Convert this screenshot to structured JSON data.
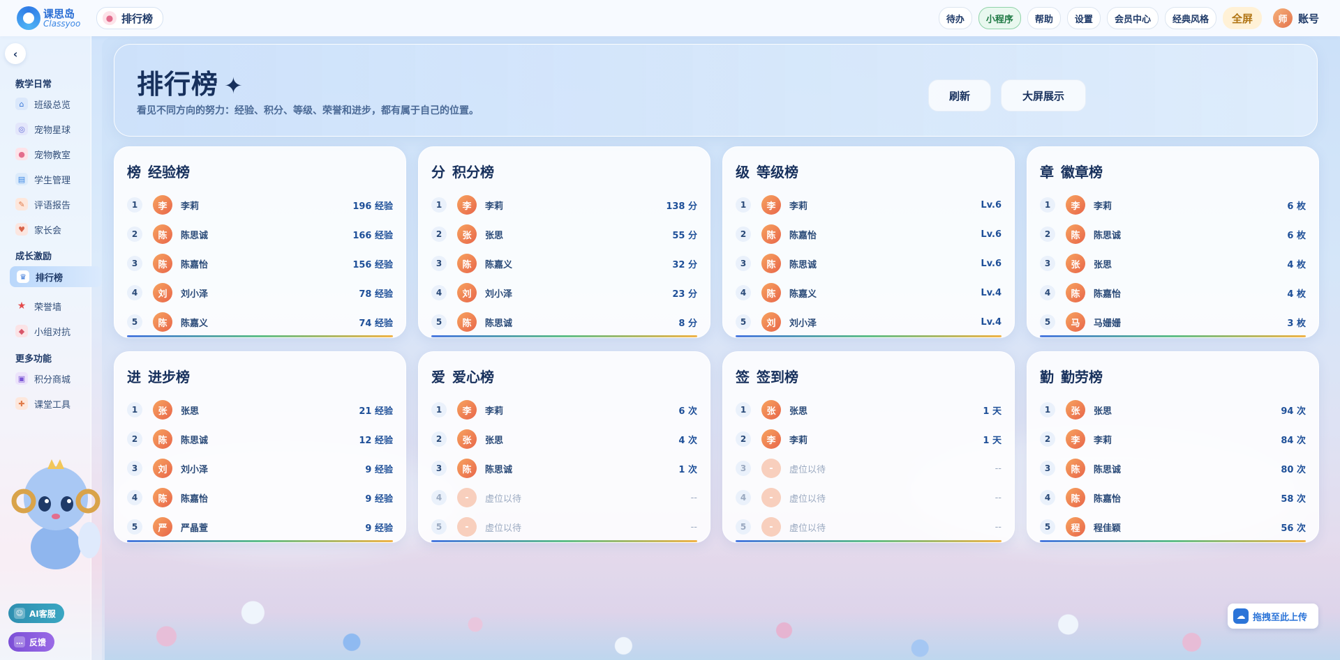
{
  "app": {
    "logo_cn": "课思岛",
    "logo_en": "Classyoo",
    "page_chip": "排行榜"
  },
  "topbar": {
    "buttons": [
      "待办",
      "小程序",
      "帮助",
      "设置",
      "会员中心",
      "经典风格"
    ],
    "fullscreen": "全屏",
    "teacher_avatar": "师",
    "account": "账号"
  },
  "sidebar": {
    "groups": [
      "教学日常",
      "成长激励",
      "更多功能"
    ],
    "items": [
      {
        "label": "班级总览",
        "icon": "home-icon"
      },
      {
        "label": "宠物星球",
        "icon": "planet-icon"
      },
      {
        "label": "宠物教室",
        "icon": "paw-icon"
      },
      {
        "label": "学生管理",
        "icon": "student-icon"
      },
      {
        "label": "评语报告",
        "icon": "report-icon"
      },
      {
        "label": "家长会",
        "icon": "parents-icon"
      },
      {
        "label": "排行榜",
        "icon": "trophy-icon"
      },
      {
        "label": "荣誉墙",
        "icon": "star-icon"
      },
      {
        "label": "小组对抗",
        "icon": "shield-icon"
      },
      {
        "label": "积分商城",
        "icon": "shop-icon"
      },
      {
        "label": "课堂工具",
        "icon": "tools-icon"
      }
    ],
    "ai_service": "AI客服",
    "feedback": "反馈"
  },
  "hero": {
    "title": "排行榜",
    "subtitle": "看见不同方向的努力：经验、积分、等级、荣誉和进步，都有属于自己的位置。",
    "refresh": "刷新",
    "big_screen": "大屏展示"
  },
  "boards": [
    {
      "icon": "榜",
      "title": "经验榜",
      "rows": [
        {
          "rank": "1",
          "avatar": "李",
          "name": "李莉",
          "value": "196 经验"
        },
        {
          "rank": "2",
          "avatar": "陈",
          "name": "陈思诚",
          "value": "166 经验"
        },
        {
          "rank": "3",
          "avatar": "陈",
          "name": "陈嘉怡",
          "value": "156 经验"
        },
        {
          "rank": "4",
          "avatar": "刘",
          "name": "刘小泽",
          "value": "78 经验"
        },
        {
          "rank": "5",
          "avatar": "陈",
          "name": "陈嘉义",
          "value": "74 经验"
        }
      ]
    },
    {
      "icon": "分",
      "title": "积分榜",
      "rows": [
        {
          "rank": "1",
          "avatar": "李",
          "name": "李莉",
          "value": "138 分"
        },
        {
          "rank": "2",
          "avatar": "张",
          "name": "张思",
          "value": "55 分"
        },
        {
          "rank": "3",
          "avatar": "陈",
          "name": "陈嘉义",
          "value": "32 分"
        },
        {
          "rank": "4",
          "avatar": "刘",
          "name": "刘小泽",
          "value": "23 分"
        },
        {
          "rank": "5",
          "avatar": "陈",
          "name": "陈思诚",
          "value": "8 分"
        }
      ]
    },
    {
      "icon": "级",
      "title": "等级榜",
      "rows": [
        {
          "rank": "1",
          "avatar": "李",
          "name": "李莉",
          "value": "Lv.6"
        },
        {
          "rank": "2",
          "avatar": "陈",
          "name": "陈嘉怡",
          "value": "Lv.6"
        },
        {
          "rank": "3",
          "avatar": "陈",
          "name": "陈思诚",
          "value": "Lv.6"
        },
        {
          "rank": "4",
          "avatar": "陈",
          "name": "陈嘉义",
          "value": "Lv.4"
        },
        {
          "rank": "5",
          "avatar": "刘",
          "name": "刘小泽",
          "value": "Lv.4"
        }
      ]
    },
    {
      "icon": "章",
      "title": "徽章榜",
      "rows": [
        {
          "rank": "1",
          "avatar": "李",
          "name": "李莉",
          "value": "6 枚"
        },
        {
          "rank": "2",
          "avatar": "陈",
          "name": "陈思诚",
          "value": "6 枚"
        },
        {
          "rank": "3",
          "avatar": "张",
          "name": "张思",
          "value": "4 枚"
        },
        {
          "rank": "4",
          "avatar": "陈",
          "name": "陈嘉怡",
          "value": "4 枚"
        },
        {
          "rank": "5",
          "avatar": "马",
          "name": "马姗姗",
          "value": "3 枚"
        }
      ]
    },
    {
      "icon": "进",
      "title": "进步榜",
      "rows": [
        {
          "rank": "1",
          "avatar": "张",
          "name": "张思",
          "value": "21 经验"
        },
        {
          "rank": "2",
          "avatar": "陈",
          "name": "陈思诚",
          "value": "12 经验"
        },
        {
          "rank": "3",
          "avatar": "刘",
          "name": "刘小泽",
          "value": "9 经验"
        },
        {
          "rank": "4",
          "avatar": "陈",
          "name": "陈嘉怡",
          "value": "9 经验"
        },
        {
          "rank": "5",
          "avatar": "严",
          "name": "严晶萱",
          "value": "9 经验"
        }
      ]
    },
    {
      "icon": "爱",
      "title": "爱心榜",
      "rows": [
        {
          "rank": "1",
          "avatar": "李",
          "name": "李莉",
          "value": "6 次"
        },
        {
          "rank": "2",
          "avatar": "张",
          "name": "张思",
          "value": "4 次"
        },
        {
          "rank": "3",
          "avatar": "陈",
          "name": "陈思诚",
          "value": "1 次"
        },
        {
          "rank": "4",
          "avatar": "-",
          "name": "虚位以待",
          "value": "--",
          "placeholder": true
        },
        {
          "rank": "5",
          "avatar": "-",
          "name": "虚位以待",
          "value": "--",
          "placeholder": true
        }
      ]
    },
    {
      "icon": "签",
      "title": "签到榜",
      "rows": [
        {
          "rank": "1",
          "avatar": "张",
          "name": "张思",
          "value": "1 天"
        },
        {
          "rank": "2",
          "avatar": "李",
          "name": "李莉",
          "value": "1 天"
        },
        {
          "rank": "3",
          "avatar": "-",
          "name": "虚位以待",
          "value": "--",
          "placeholder": true
        },
        {
          "rank": "4",
          "avatar": "-",
          "name": "虚位以待",
          "value": "--",
          "placeholder": true
        },
        {
          "rank": "5",
          "avatar": "-",
          "name": "虚位以待",
          "value": "--",
          "placeholder": true
        }
      ]
    },
    {
      "icon": "勤",
      "title": "勤劳榜",
      "rows": [
        {
          "rank": "1",
          "avatar": "张",
          "name": "张思",
          "value": "94 次"
        },
        {
          "rank": "2",
          "avatar": "李",
          "name": "李莉",
          "value": "84 次"
        },
        {
          "rank": "3",
          "avatar": "陈",
          "name": "陈思诚",
          "value": "80 次"
        },
        {
          "rank": "4",
          "avatar": "陈",
          "name": "陈嘉怡",
          "value": "58 次"
        },
        {
          "rank": "5",
          "avatar": "程",
          "name": "程佳颖",
          "value": "56 次"
        }
      ]
    }
  ],
  "upload": "拖拽至此上传",
  "colors": {
    "primary_text": "#17305c",
    "accent_blue": "#1e4f98",
    "mini_program_green": "#1f7a44",
    "fullscreen_gold": "#b07413",
    "avatar_orange": "#e8664a"
  }
}
